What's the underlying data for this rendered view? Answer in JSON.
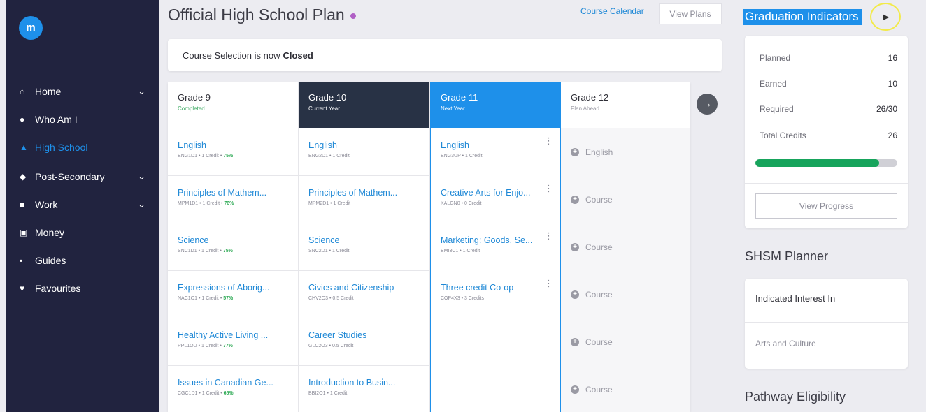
{
  "sidebar": {
    "logo": "m",
    "items": [
      {
        "label": "Home",
        "icon": "home-icon",
        "glyph": "⌂",
        "chevron": true,
        "active": false
      },
      {
        "label": "Who Am I",
        "icon": "person-icon",
        "glyph": "●",
        "chevron": false,
        "active": false
      },
      {
        "label": "High School",
        "icon": "school-icon",
        "glyph": "▲",
        "chevron": false,
        "active": true
      },
      {
        "label": "Post-Secondary",
        "icon": "graduation-cap-icon",
        "glyph": "◆",
        "chevron": true,
        "active": false
      },
      {
        "label": "Work",
        "icon": "briefcase-icon",
        "glyph": "■",
        "chevron": true,
        "active": false
      },
      {
        "label": "Money",
        "icon": "money-icon",
        "glyph": "▣",
        "chevron": false,
        "active": false
      },
      {
        "label": "Guides",
        "icon": "book-icon",
        "glyph": "▪",
        "chevron": false,
        "active": false
      },
      {
        "label": "Favourites",
        "icon": "heart-icon",
        "glyph": "♥",
        "chevron": false,
        "active": false
      }
    ]
  },
  "header": {
    "title": "Official High School Plan",
    "course_calendar": "Course Calendar",
    "view_plans": "View Plans"
  },
  "notice": {
    "text": "Course Selection is now",
    "status": "Closed"
  },
  "grades": [
    {
      "grade": "Grade 9",
      "status": "Completed",
      "courses": [
        {
          "name": "English",
          "code": "ENG1D1",
          "credit": "1 Credit",
          "pct": "75%"
        },
        {
          "name": "Principles of Mathem...",
          "code": "MPM1D1",
          "credit": "1 Credit",
          "pct": "76%"
        },
        {
          "name": "Science",
          "code": "SNC1D1",
          "credit": "1 Credit",
          "pct": "75%"
        },
        {
          "name": "Expressions of Aborig...",
          "code": "NAC1O1",
          "credit": "1 Credit",
          "pct": "57%"
        },
        {
          "name": "Healthy Active Living ...",
          "code": "PPL1OU",
          "credit": "1 Credit",
          "pct": "77%"
        },
        {
          "name": "Issues in Canadian Ge...",
          "code": "CGC1D1",
          "credit": "1 Credit",
          "pct": "65%"
        }
      ]
    },
    {
      "grade": "Grade 10",
      "status": "Current Year",
      "courses": [
        {
          "name": "English",
          "code": "ENG2D1",
          "credit": "1 Credit",
          "pct": ""
        },
        {
          "name": "Principles of Mathem...",
          "code": "MPM2D1",
          "credit": "1 Credit",
          "pct": ""
        },
        {
          "name": "Science",
          "code": "SNC2D1",
          "credit": "1 Credit",
          "pct": ""
        },
        {
          "name": "Civics and Citizenship",
          "code": "CHV2O3",
          "credit": "0.5 Credit",
          "pct": ""
        },
        {
          "name": "Career Studies",
          "code": "GLC2O3",
          "credit": "0.5 Credit",
          "pct": ""
        },
        {
          "name": "Introduction to Busin...",
          "code": "BBI2O1",
          "credit": "1 Credit",
          "pct": ""
        }
      ]
    },
    {
      "grade": "Grade 11",
      "status": "Next Year",
      "courses": [
        {
          "name": "English",
          "code": "ENG3UP",
          "credit": "1 Credit",
          "pct": ""
        },
        {
          "name": "Creative Arts for Enjo...",
          "code": "KALGN0",
          "credit": "0 Credit",
          "pct": ""
        },
        {
          "name": "Marketing: Goods, Se...",
          "code": "BMI3C1",
          "credit": "1 Credit",
          "pct": ""
        },
        {
          "name": "Three credit Co-op",
          "code": "COP4X3",
          "credit": "3 Credits",
          "pct": ""
        }
      ]
    },
    {
      "grade": "Grade 12",
      "status": "Plan Ahead",
      "slots": [
        "English",
        "Course",
        "Course",
        "Course",
        "Course",
        "Course"
      ]
    }
  ],
  "graduation": {
    "title": "Graduation Indicators",
    "rows": [
      {
        "label": "Planned",
        "value": "16"
      },
      {
        "label": "Earned",
        "value": "10"
      },
      {
        "label": "Required",
        "value": "26/30"
      },
      {
        "label": "Total Credits",
        "value": "26"
      }
    ],
    "progress_fraction": 0.87,
    "progress_color": "#17a45c",
    "view_progress": "View Progress"
  },
  "shsm": {
    "title": "SHSM Planner",
    "indicated": "Indicated Interest In",
    "interest": "Arts and Culture"
  },
  "pathway": {
    "title": "Pathway Eligibility"
  }
}
